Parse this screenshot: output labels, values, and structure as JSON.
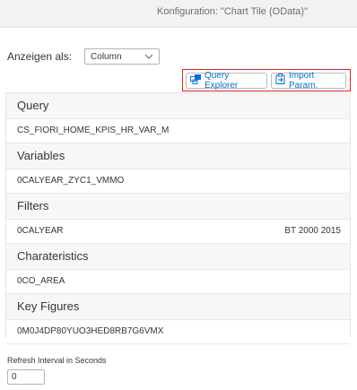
{
  "header": {
    "title": "Konfiguration: \"Chart Tile (OData)\""
  },
  "display": {
    "label": "Anzeigen als:",
    "selected": "Column"
  },
  "toolbar": {
    "query_explorer": "Query Explorer",
    "import_params": "Import Param."
  },
  "sections": [
    {
      "title": "Query",
      "value": "CS_FIORI_HOME_KPIS_HR_VAR_M",
      "extra": ""
    },
    {
      "title": "Variables",
      "value": "0CALYEAR_ZYC1_VMMO",
      "extra": ""
    },
    {
      "title": "Filters",
      "value": "0CALYEAR",
      "extra": "BT 2000 2015"
    },
    {
      "title": "Charateristics",
      "value": "0CO_AREA",
      "extra": ""
    },
    {
      "title": "Key Figures",
      "value": "0M0J4DP80YUO3HED8RB7G6VMX",
      "extra": ""
    }
  ],
  "refresh": {
    "label": "Refresh Interval in Seconds",
    "value": "0"
  },
  "colors": {
    "accent": "#0a6ed1",
    "highlight_border": "#d9262c"
  },
  "icons": {
    "query_explorer": "query-explorer-icon",
    "import_params": "clipboard-import-icon",
    "dropdown": "chevron-down-icon"
  }
}
